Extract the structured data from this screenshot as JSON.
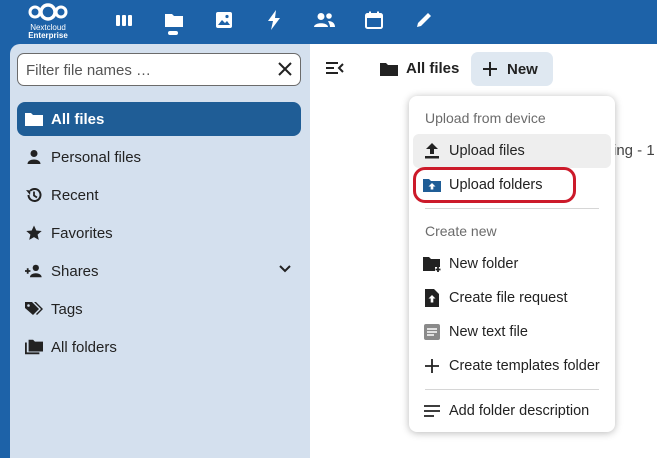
{
  "header": {
    "logo_line1": "Nextcloud",
    "logo_line2": "Enterprise",
    "apps": [
      {
        "name": "dashboard-icon"
      },
      {
        "name": "files-icon"
      },
      {
        "name": "photos-icon"
      },
      {
        "name": "activity-icon"
      },
      {
        "name": "contacts-icon"
      },
      {
        "name": "calendar-icon"
      },
      {
        "name": "notes-icon"
      }
    ]
  },
  "sidebar": {
    "search_placeholder": "Filter file names …",
    "items": [
      {
        "label": "All files",
        "icon": "folder-icon",
        "active": true
      },
      {
        "label": "Personal files",
        "icon": "person-icon"
      },
      {
        "label": "Recent",
        "icon": "history-icon"
      },
      {
        "label": "Favorites",
        "icon": "star-icon"
      },
      {
        "label": "Shares",
        "icon": "share-icon"
      },
      {
        "label": "Tags",
        "icon": "tag-icon"
      },
      {
        "label": "All folders",
        "icon": "folders-icon"
      }
    ]
  },
  "main": {
    "breadcrumb": "All files",
    "new_label": "New",
    "background_text": "ing - 1"
  },
  "menu": {
    "upload_header": "Upload from device",
    "upload_files": "Upload files",
    "upload_folders": "Upload folders",
    "create_header": "Create new",
    "new_folder": "New folder",
    "create_file_request": "Create file request",
    "new_text_file": "New text file",
    "create_templates_folder": "Create templates folder",
    "add_folder_description": "Add folder description"
  },
  "colors": {
    "header": "#1d62a8",
    "sidebar": "#d4e0ee",
    "active_item": "#1f5d96",
    "highlight": "#cc1a2a"
  }
}
